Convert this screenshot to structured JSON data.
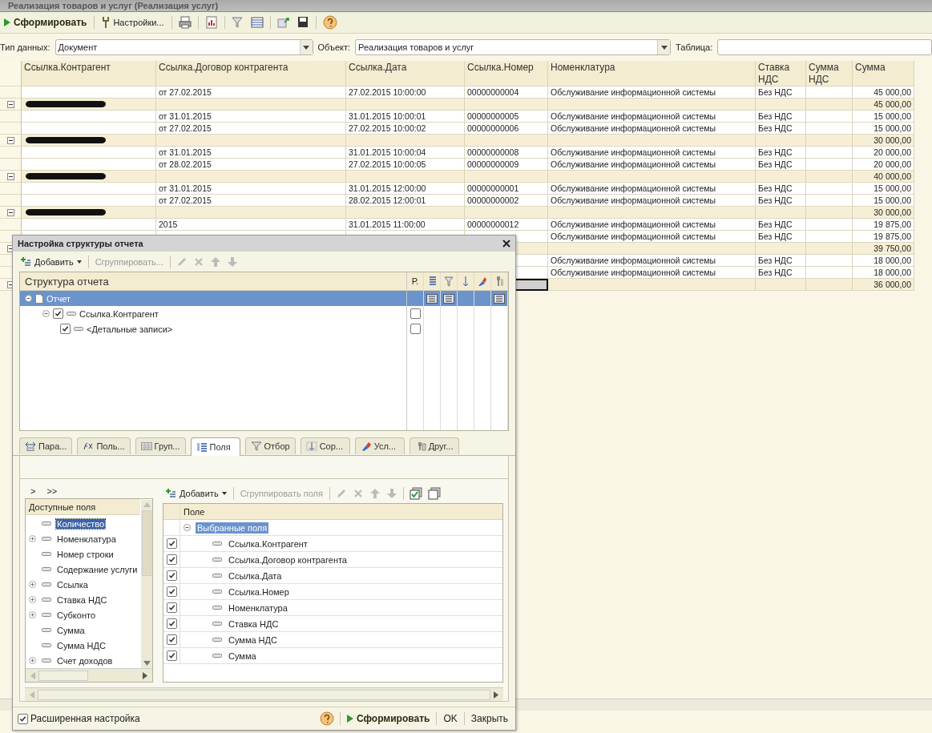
{
  "window": {
    "title": "Реализация товаров и услуг (Реализация услуг)"
  },
  "toolbar": {
    "run_label": "Сформировать",
    "settings_label": "Настройки..."
  },
  "filters": [
    {
      "label": "Тип данных:",
      "value": "Документ",
      "dropdown": true
    },
    {
      "label": "Объект:",
      "value": "Реализация товаров и услуг",
      "dropdown": true
    },
    {
      "label": "Таблица:",
      "dropdown": false
    }
  ],
  "table": {
    "columns": [
      "Ссылка.Контрагент",
      "Ссылка.Договор контрагента",
      "Ссылка.Дата",
      "Ссылка.Номер",
      "Номенклатура",
      "Ставка НДС",
      "Сумма НДС",
      "Сумма"
    ],
    "rows": [
      {
        "kind": "detail",
        "selected": false,
        "contract": "от 27.02.2015",
        "date": "27.02.2015 10:00:00",
        "number": "00000000004",
        "item": "Обслуживание информационной системы",
        "vat_rate": "Без НДС",
        "sum": "45 000,00"
      },
      {
        "kind": "group",
        "selected": false,
        "sum": "45 000,00"
      },
      {
        "kind": "detail",
        "selected": false,
        "contract": "от 31.01.2015",
        "date": "31.01.2015 10:00:01",
        "number": "00000000005",
        "item": "Обслуживание информационной системы",
        "vat_rate": "Без НДС",
        "sum": "15 000,00"
      },
      {
        "kind": "detail",
        "selected": false,
        "contract": "от 27.02.2015",
        "date": "27.02.2015 10:00:02",
        "number": "00000000006",
        "item": "Обслуживание информационной системы",
        "vat_rate": "Без НДС",
        "sum": "15 000,00"
      },
      {
        "kind": "group",
        "selected": false,
        "sum": "30 000,00"
      },
      {
        "kind": "detail",
        "selected": false,
        "contract": "от 31.01.2015",
        "date": "31.01.2015 10:00:04",
        "number": "00000000008",
        "item": "Обслуживание информационной системы",
        "vat_rate": "Без НДС",
        "sum": "20 000,00"
      },
      {
        "kind": "detail",
        "selected": false,
        "contract": "от 28.02.2015",
        "date": "27.02.2015 10:00:05",
        "number": "00000000009",
        "item": "Обслуживание информационной системы",
        "vat_rate": "Без НДС",
        "sum": "20 000,00"
      },
      {
        "kind": "group",
        "selected": false,
        "sum": "40 000,00"
      },
      {
        "kind": "detail",
        "selected": false,
        "contract": "от 31.01.2015",
        "date": "31.01.2015 12:00:00",
        "number": "00000000001",
        "item": "Обслуживание информационной системы",
        "vat_rate": "Без НДС",
        "sum": "15 000,00"
      },
      {
        "kind": "detail",
        "selected": false,
        "contract": "от 27.02.2015",
        "date": "28.02.2015 12:00:01",
        "number": "00000000002",
        "item": "Обслуживание информационной системы",
        "vat_rate": "Без НДС",
        "sum": "15 000,00"
      },
      {
        "kind": "group",
        "selected": false,
        "sum": "30 000,00"
      },
      {
        "kind": "detail",
        "selected": false,
        "contract": "2015",
        "date": "31.01.2015 11:00:00",
        "number": "00000000012",
        "item": "Обслуживание информационной системы",
        "vat_rate": "Без НДС",
        "sum": "19 875,00"
      },
      {
        "kind": "detail",
        "selected": false,
        "item": "Обслуживание информационной системы",
        "vat_rate": "Без НДС",
        "sum": "19 875,00"
      },
      {
        "kind": "group",
        "selected": false,
        "sum": "39 750,00"
      },
      {
        "kind": "detail",
        "selected": false,
        "item": "Обслуживание информационной системы",
        "vat_rate": "Без НДС",
        "sum": "18 000,00"
      },
      {
        "kind": "detail",
        "selected": false,
        "item": "Обслуживание информационной системы",
        "vat_rate": "Без НДС",
        "sum": "18 000,00"
      },
      {
        "kind": "group",
        "selected": true,
        "sum": "36 000,00"
      }
    ]
  },
  "dialog": {
    "title": "Настройка структуры отчета",
    "toolbar": {
      "add_label": "Добавить",
      "group_label": "Сгруппировать..."
    },
    "structure": {
      "heading": "Структура отчета",
      "flag_heading": "Р.",
      "items": [
        {
          "label": "Отчет",
          "selected": true,
          "expanded": true,
          "children": [
            {
              "label": "Ссылка.Контрагент",
              "selected": false,
              "checked": true,
              "expanded": true,
              "flag": false,
              "children": [
                {
                  "label": "<Детальные записи>",
                  "selected": false,
                  "checked": true,
                  "flag": false
                }
              ]
            }
          ]
        }
      ]
    },
    "tabs": [
      {
        "label": "Пара...",
        "selected": false
      },
      {
        "label": "Поль...",
        "selected": false
      },
      {
        "label": "Груп...",
        "selected": false
      },
      {
        "label": "Поля",
        "selected": true
      },
      {
        "label": "Отбор",
        "selected": false
      },
      {
        "label": "Сор...",
        "selected": false
      },
      {
        "label": "Усл...",
        "selected": false
      },
      {
        "label": "Друг...",
        "selected": false
      }
    ],
    "move_buttons": [
      ">",
      ">>"
    ],
    "available": {
      "heading": "Доступные поля",
      "items": [
        {
          "label": "Количество",
          "expandable": false,
          "selected": true
        },
        {
          "label": "Номенклатура",
          "expandable": true,
          "selected": false
        },
        {
          "label": "Номер строки",
          "expandable": false,
          "selected": false
        },
        {
          "label": "Содержание услуги",
          "expandable": false,
          "selected": false
        },
        {
          "label": "Ссылка",
          "expandable": true,
          "selected": false
        },
        {
          "label": "Ставка НДС",
          "expandable": true,
          "selected": false
        },
        {
          "label": "Субконто",
          "expandable": true,
          "selected": false
        },
        {
          "label": "Сумма",
          "expandable": false,
          "selected": false
        },
        {
          "label": "Сумма НДС",
          "expandable": false,
          "selected": false
        },
        {
          "label": "Счет доходов",
          "expandable": true,
          "selected": false
        }
      ]
    },
    "fields_toolbar": {
      "add_label": "Добавить",
      "group_label": "Сгруппировать поля"
    },
    "selected_fields": {
      "heading": "Поле",
      "group_label": "Выбранные поля",
      "items": [
        {
          "label": "Ссылка.Контрагент",
          "checked": true
        },
        {
          "label": "Ссылка.Договор контрагента",
          "checked": true
        },
        {
          "label": "Ссылка.Дата",
          "checked": true
        },
        {
          "label": "Ссылка.Номер",
          "checked": true
        },
        {
          "label": "Номенклатура",
          "checked": true
        },
        {
          "label": "Ставка НДС",
          "checked": true
        },
        {
          "label": "Сумма НДС",
          "checked": true
        },
        {
          "label": "Сумма",
          "checked": true
        }
      ]
    },
    "footer": {
      "advanced_label": "Расширенная настройка",
      "advanced_checked": true,
      "run_label": "Сформировать",
      "ok_label": "OK",
      "close_label": "Закрыть"
    }
  }
}
